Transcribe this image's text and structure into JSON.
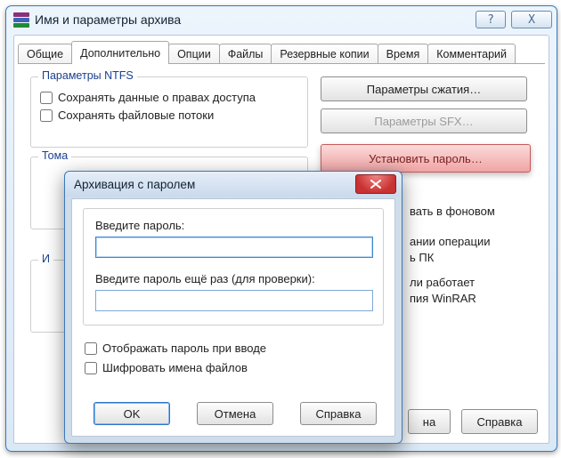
{
  "win1": {
    "title": "Имя и параметры архива",
    "help_glyph": "?",
    "close_glyph": "X",
    "tabs": [
      "Общие",
      "Дополнительно",
      "Опции",
      "Файлы",
      "Резервные копии",
      "Время",
      "Комментарий"
    ],
    "active_tab": 1,
    "ntfs": {
      "legend": "Параметры NTFS",
      "opt_rights": "Сохранять данные о правах доступа",
      "opt_streams": "Сохранять файловые потоки"
    },
    "volumes": {
      "legend": "Тома"
    },
    "side": {
      "compress": "Параметры сжатия…",
      "sfx": "Параметры SFX…",
      "password": "Установить пароль…",
      "bg_tail": "вать в фоновом",
      "op_tail1": "ании операции",
      "op_tail2": "ь ПК",
      "wr_tail1": "ли работает",
      "wr_tail2": "пия WinRAR"
    },
    "info": {
      "sigil": "И"
    },
    "footer": {
      "btn_na": "на",
      "btn_help": "Справка"
    }
  },
  "win2": {
    "title": "Архивация с паролем",
    "enter_pw": "Введите пароль:",
    "enter_pw2": "Введите пароль ещё раз (для проверки):",
    "show_pw": "Отображать пароль при вводе",
    "encrypt_names": "Шифровать имена файлов",
    "ok": "OK",
    "cancel": "Отмена",
    "help": "Справка"
  }
}
